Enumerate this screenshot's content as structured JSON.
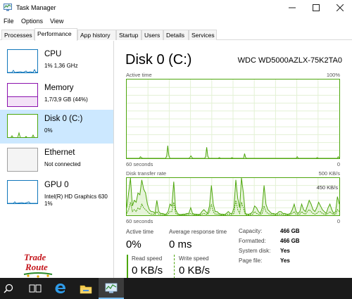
{
  "window": {
    "title": "Task Manager"
  },
  "menu": [
    "File",
    "Options",
    "View"
  ],
  "tabs": [
    "Processes",
    "Performance",
    "App history",
    "Startup",
    "Users",
    "Details",
    "Services"
  ],
  "sidebar": {
    "items": [
      {
        "name": "CPU",
        "sub": "1% 1,36 GHz",
        "sub2": ""
      },
      {
        "name": "Memory",
        "sub": "1,7/3,9 GB (44%)",
        "sub2": ""
      },
      {
        "name": "Disk 0 (C:)",
        "sub": "0%",
        "sub2": ""
      },
      {
        "name": "Ethernet",
        "sub": "Not connected",
        "sub2": ""
      },
      {
        "name": "GPU 0",
        "sub": "Intel(R) HD Graphics 630",
        "sub2": "1%"
      }
    ]
  },
  "main": {
    "title": "Disk 0 (C:)",
    "model": "WDC WD5000AZLX-75K2TA0",
    "active_graph": {
      "label": "Active time",
      "max_label": "100%",
      "x_left": "60 seconds",
      "x_right": "0",
      "values": [
        0,
        0,
        0,
        0,
        0,
        0,
        0,
        0,
        0,
        0,
        0,
        0,
        0,
        2,
        1,
        0,
        0,
        0,
        0,
        0,
        0,
        0,
        0,
        0,
        0,
        0,
        0,
        0,
        0,
        0,
        0,
        0,
        0,
        0,
        0,
        0,
        0,
        0,
        3,
        16,
        4,
        0,
        0,
        0,
        0,
        0,
        0,
        0,
        0,
        0,
        0,
        0,
        0,
        0,
        0,
        0,
        0,
        0,
        0,
        0,
        1,
        3,
        1,
        0,
        0,
        0,
        0,
        0,
        0,
        0,
        0,
        0,
        0,
        0,
        0,
        2,
        14,
        3,
        0,
        0,
        0,
        0,
        0,
        0,
        0,
        0,
        0,
        0,
        1,
        0,
        0,
        0,
        0,
        0,
        0,
        0,
        0,
        0,
        0,
        0,
        1,
        0,
        0,
        0,
        0,
        0,
        0,
        0,
        0,
        0,
        0,
        0,
        6,
        1,
        0,
        0,
        0,
        0,
        0,
        0,
        0,
        0,
        0,
        0,
        0,
        0,
        0,
        0,
        0,
        0,
        0,
        0,
        0,
        0,
        0,
        0,
        0,
        0,
        0,
        0,
        0,
        0,
        0,
        0,
        0,
        0,
        0,
        0,
        0,
        0,
        0,
        0,
        0,
        0,
        0,
        0,
        0,
        0,
        0,
        0,
        0,
        0,
        2,
        0,
        0,
        0,
        0,
        0,
        0,
        0,
        0,
        0,
        0,
        0,
        0,
        0,
        0,
        0,
        0,
        0,
        0,
        1,
        0,
        0,
        0,
        0,
        0,
        0,
        0,
        0,
        0,
        0,
        0,
        0,
        0,
        0,
        0,
        0,
        0,
        0,
        0,
        2,
        0
      ]
    },
    "transfer_graph": {
      "label": "Disk transfer rate",
      "max_label": "500 KB/s",
      "inner_label": "450 KB/s",
      "x_left": "60 seconds",
      "x_right": "0",
      "values": [
        20,
        60,
        100,
        25,
        40,
        35,
        60,
        55,
        95,
        70,
        60,
        30,
        15,
        10,
        10,
        5,
        40,
        10,
        5,
        5,
        3,
        3,
        10,
        30,
        25,
        90,
        15,
        5,
        2,
        2,
        3,
        3,
        5,
        5,
        20,
        5,
        3,
        3,
        2,
        3,
        10,
        15,
        10,
        5,
        25,
        80,
        30,
        10,
        10,
        5,
        3,
        3,
        2,
        5,
        10,
        5,
        5,
        20,
        95,
        45,
        20,
        100,
        60,
        5,
        3,
        3,
        5,
        10,
        25,
        20,
        10,
        5,
        20,
        80,
        30,
        15,
        10,
        5,
        5,
        3,
        5,
        10,
        10,
        5,
        5,
        3,
        3,
        5,
        15,
        30,
        10,
        5,
        10,
        30,
        15,
        10,
        25,
        40,
        30,
        15,
        10,
        20,
        35,
        25,
        15,
        10,
        5,
        20,
        30,
        15,
        5,
        10,
        50,
        30
      ],
      "values2": [
        5,
        15,
        35,
        10,
        15,
        10,
        20,
        15,
        30,
        20,
        15,
        10,
        5,
        3,
        3,
        2,
        10,
        3,
        2,
        2,
        1,
        1,
        3,
        10,
        10,
        35,
        5,
        2,
        1,
        1,
        1,
        1,
        2,
        2,
        5,
        2,
        1,
        1,
        1,
        1,
        3,
        5,
        3,
        2,
        10,
        30,
        10,
        3,
        3,
        2,
        1,
        1,
        1,
        2,
        3,
        2,
        2,
        5,
        40,
        15,
        5,
        35,
        20,
        2,
        1,
        1,
        2,
        3,
        10,
        5,
        3,
        2,
        5,
        25,
        10,
        5,
        3,
        2,
        2,
        1,
        2,
        3,
        3,
        2,
        2,
        1,
        1,
        2,
        5,
        10,
        3,
        2,
        3,
        10,
        5,
        3,
        10,
        15,
        10,
        5,
        3,
        5,
        10,
        10,
        5,
        3,
        2,
        5,
        10,
        5,
        2,
        3,
        15,
        10
      ]
    },
    "stats": {
      "active_time_label": "Active time",
      "active_time": "0%",
      "avg_resp_label": "Average response time",
      "avg_resp": "0 ms",
      "read_label": "Read speed",
      "read": "0 KB/s",
      "write_label": "Write speed",
      "write": "0 KB/s"
    },
    "props": [
      {
        "label": "Capacity:",
        "value": "466 GB"
      },
      {
        "label": "Formatted:",
        "value": "466 GB"
      },
      {
        "label": "System disk:",
        "value": "Yes"
      },
      {
        "label": "Page file:",
        "value": "Yes"
      }
    ]
  },
  "watermark": {
    "line1": "Trade",
    "line2": "Route"
  },
  "colors": {
    "cpu": "#1177bb",
    "memory": "#8b12ae",
    "disk": "#4da60c",
    "ethernet": "#a0a0a0",
    "gpu": "#1177bb",
    "selected": "#cce8ff",
    "taskbar": "#1b1b1b"
  }
}
